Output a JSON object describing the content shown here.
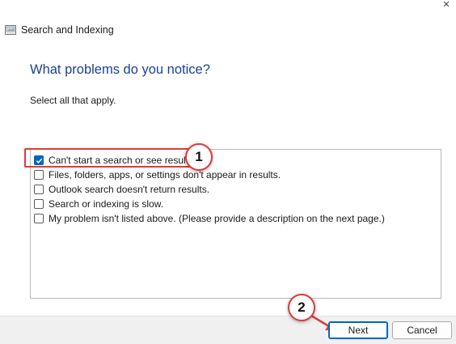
{
  "window": {
    "title": "Search and Indexing",
    "close_glyph": "×"
  },
  "page": {
    "heading": "What problems do you notice?",
    "subtext": "Select all that apply."
  },
  "options": [
    {
      "label": "Can't start a search or see results.",
      "checked": true
    },
    {
      "label": "Files, folders, apps, or settings don't appear in results.",
      "checked": false
    },
    {
      "label": "Outlook search doesn't return results.",
      "checked": false
    },
    {
      "label": "Search or indexing is slow.",
      "checked": false
    },
    {
      "label": "My problem isn't listed above. (Please provide a description on the next page.)",
      "checked": false
    }
  ],
  "annotations": {
    "badge_1": "1",
    "badge_2": "2"
  },
  "buttons": {
    "next": "Next",
    "cancel": "Cancel"
  },
  "colors": {
    "accent": "#0067c0",
    "heading": "#1c3f94",
    "annotation_red": "#e03a3a"
  },
  "icons": {
    "app": "search-indexing-icon",
    "close": "close-icon",
    "check": "checkmark-icon"
  }
}
